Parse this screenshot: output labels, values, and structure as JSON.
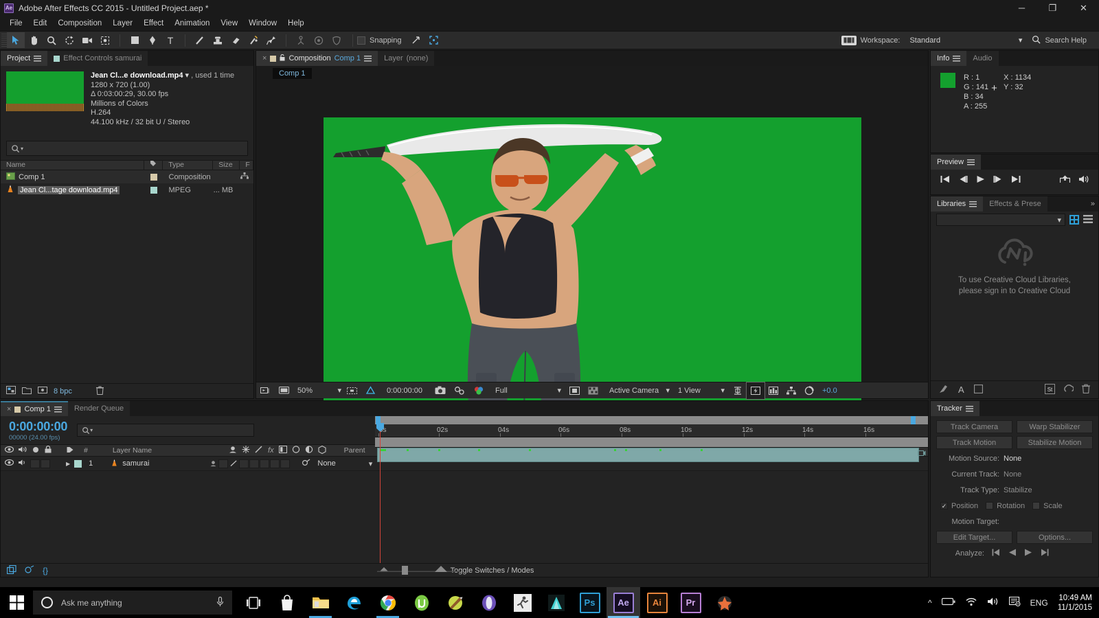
{
  "window": {
    "title": "Adobe After Effects CC 2015 - Untitled Project.aep *",
    "app_badge": "Ae",
    "minimize": "─",
    "maximize": "❐",
    "close": "✕"
  },
  "menubar": {
    "items": [
      "File",
      "Edit",
      "Composition",
      "Layer",
      "Effect",
      "Animation",
      "View",
      "Window",
      "Help"
    ]
  },
  "toolbar": {
    "tools": [
      {
        "name": "selection-tool",
        "glyph": "↖"
      },
      {
        "name": "hand-tool",
        "glyph": "✋"
      },
      {
        "name": "zoom-tool",
        "glyph": "⚲"
      },
      {
        "name": "rotation-tool",
        "glyph": "↻"
      },
      {
        "name": "camera-tool",
        "glyph": "◱"
      },
      {
        "name": "pan-behind-tool",
        "glyph": "✣"
      },
      {
        "name": "shape-tool",
        "glyph": "■"
      },
      {
        "name": "pen-tool",
        "glyph": "✒"
      },
      {
        "name": "type-tool",
        "glyph": "T"
      },
      {
        "name": "brush-tool",
        "glyph": "╱"
      },
      {
        "name": "clone-stamp-tool",
        "glyph": "⚓"
      },
      {
        "name": "eraser-tool",
        "glyph": "▱"
      },
      {
        "name": "roto-brush-tool",
        "glyph": "✎"
      },
      {
        "name": "puppet-pin-tool",
        "glyph": "✒"
      }
    ],
    "snapping_label": "Snapping",
    "workspace_label": "Workspace:",
    "workspace_value": "Standard",
    "search_help": "Search Help"
  },
  "project_panel": {
    "tabs": [
      {
        "label": "Project",
        "selected": true
      },
      {
        "label": "Effect Controls samurai",
        "selected": false
      }
    ],
    "asset": {
      "filename": "Jean Cl...e download.mp4",
      "used": ", used 1 time",
      "dimensions": "1280 x 720 (1.00)",
      "duration": "Δ 0:03:00:29, 30.00 fps",
      "colors": "Millions of Colors",
      "codec": "H.264",
      "audio": "44.100 kHz / 32 bit U / Stereo"
    },
    "columns": [
      "Name",
      "Type",
      "Size",
      "F"
    ],
    "rows": [
      {
        "name": "Comp 1",
        "type": "Composition",
        "size": "",
        "icon": "composition-icon"
      },
      {
        "name": "Jean Cl...tage download.mp4",
        "type": "MPEG",
        "size": "... MB",
        "icon": "vlc-icon"
      }
    ],
    "footer": {
      "bpc": "8 bpc"
    }
  },
  "comp_panel": {
    "tabs": [
      {
        "label": "Composition",
        "value": "Comp 1",
        "selected": true
      },
      {
        "label": "Layer",
        "value": "(none)",
        "selected": false
      }
    ],
    "subtab": "Comp 1",
    "footer": {
      "zoom": "50%",
      "timecode": "0:00:00:00",
      "resolution": "Full",
      "camera": "Active Camera",
      "views": "1 View",
      "exposure": "+0.0"
    }
  },
  "info_panel": {
    "tabs": [
      "Info",
      "Audio"
    ],
    "swatch_color": "#14a02e",
    "channels": [
      {
        "label": "R :",
        "value": "1"
      },
      {
        "label": "G :",
        "value": "141"
      },
      {
        "label": "B :",
        "value": "34"
      },
      {
        "label": "A :",
        "value": "255"
      }
    ],
    "coords": [
      {
        "label": "X :",
        "value": "1134"
      },
      {
        "label": "Y :",
        "value": "32"
      }
    ]
  },
  "preview_panel": {
    "title": "Preview",
    "buttons": [
      "first-frame",
      "prev-frame",
      "play",
      "next-frame",
      "last-frame",
      "share",
      "audio"
    ]
  },
  "libraries_panel": {
    "tabs": [
      {
        "label": "Libraries",
        "selected": true
      },
      {
        "label": "Effects & Prese",
        "selected": false
      }
    ],
    "empty_message_line1": "To use Creative Cloud Libraries,",
    "empty_message_line2": "please sign in to Creative Cloud",
    "footer_icons": [
      "brush-icon",
      "text-icon",
      "square-icon",
      "st-icon",
      "cloud-icon",
      "trash-icon"
    ]
  },
  "tracker_panel": {
    "title": "Tracker",
    "buttons": [
      [
        "Track Camera",
        "Warp Stabilizer"
      ],
      [
        "Track Motion",
        "Stabilize Motion"
      ]
    ],
    "fields": [
      {
        "label": "Motion Source:",
        "value": "None",
        "bright": true
      },
      {
        "label": "Current Track:",
        "value": "None",
        "bright": false
      },
      {
        "label": "Track Type:",
        "value": "Stabilize",
        "bright": false
      }
    ],
    "checkboxes": [
      {
        "label": "Position",
        "checked": true
      },
      {
        "label": "Rotation",
        "checked": false
      },
      {
        "label": "Scale",
        "checked": false
      }
    ],
    "motion_target_label": "Motion Target:",
    "edit_target": "Edit Target...",
    "options": "Options...",
    "analyze_label": "Analyze:"
  },
  "timeline_panel": {
    "tabs": [
      {
        "label": "Comp 1",
        "selected": true
      },
      {
        "label": "Render Queue",
        "selected": false
      }
    ],
    "timecode": "0:00:00:00",
    "frames": "00000 (24.00 fps)",
    "columns": [
      "Layer Name",
      "Parent"
    ],
    "layers": [
      {
        "index": "1",
        "name": "samurai",
        "parent": "None"
      }
    ],
    "ruler_ticks": [
      "0s",
      "02s",
      "04s",
      "06s",
      "08s",
      "10s",
      "12s",
      "14s",
      "16s"
    ],
    "footer_label": "Toggle Switches / Modes"
  },
  "taskbar": {
    "search_placeholder": "Ask me anything",
    "apps": [
      {
        "name": "task-view",
        "glyph": "❐",
        "color": "#ffffff",
        "bg": "transparent",
        "open": false
      },
      {
        "name": "store-icon",
        "glyph": "ὬD",
        "color": "#ffffff",
        "bg": "transparent",
        "open": false
      },
      {
        "name": "file-explorer-icon",
        "glyph": "▰",
        "color": "#f2b632",
        "bg": "transparent",
        "open": true
      },
      {
        "name": "edge-icon",
        "glyph": "e",
        "color": "#2f9fd6",
        "bg": "transparent",
        "open": false
      },
      {
        "name": "chrome-icon",
        "glyph": "◉",
        "color": "#e8453c",
        "bg": "transparent",
        "open": true
      },
      {
        "name": "utorrent-icon",
        "glyph": "μ",
        "color": "#7ac943",
        "bg": "transparent",
        "open": false
      },
      {
        "name": "paint-icon",
        "glyph": "✐",
        "color": "#b8d44a",
        "bg": "transparent",
        "open": false
      },
      {
        "name": "opera-icon",
        "glyph": "O",
        "color": "#7c5ec4",
        "bg": "transparent",
        "open": false
      },
      {
        "name": "runner-icon",
        "glyph": "☼",
        "color": "#555555",
        "bg": "#e8e8e8",
        "open": false
      },
      {
        "name": "maya-icon",
        "glyph": "▲",
        "color": "#3fd0d0",
        "bg": "transparent",
        "open": false
      },
      {
        "name": "photoshop-icon",
        "glyph": "Ps",
        "color": "#2f9fd6",
        "bg": "transparent",
        "open": false
      },
      {
        "name": "aftereffects-icon",
        "glyph": "Ae",
        "color": "#9a7fd6",
        "bg": "transparent",
        "open": true
      },
      {
        "name": "illustrator-icon",
        "glyph": "Ai",
        "color": "#e8853c",
        "bg": "transparent",
        "open": false
      },
      {
        "name": "premiere-icon",
        "glyph": "Pr",
        "color": "#b87fd6",
        "bg": "transparent",
        "open": false
      },
      {
        "name": "misc-icon",
        "glyph": "✦",
        "color": "#e86a3c",
        "bg": "transparent",
        "open": false
      }
    ],
    "tray": {
      "language": "ENG",
      "time": "10:49 AM",
      "date": "11/1/2015"
    }
  }
}
